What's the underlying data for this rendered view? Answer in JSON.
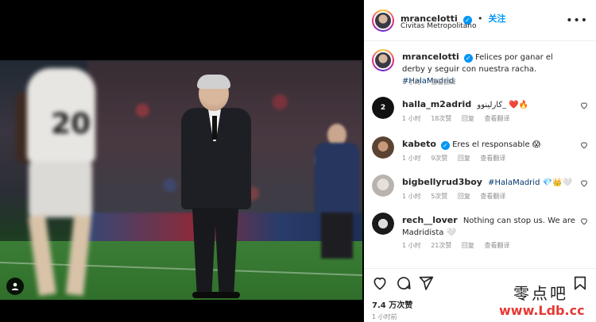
{
  "post": {
    "username": "mrancelotti",
    "follow_label": "关注",
    "location": "Civitas Metropolitano",
    "caption": {
      "username": "mrancelotti",
      "text": "Felices por ganar el derby y seguir con nuestra racha.",
      "hashtag": "#HalaMadrid",
      "time": "1 小时",
      "translate": "查看翻译"
    },
    "comments": [
      {
        "username": "halla_m2adrid",
        "text": "كارلينوو_ ❤️🔥",
        "time": "1 小时",
        "likes": "18次赞",
        "reply": "回复",
        "translate": "查看翻译"
      },
      {
        "username": "kabeto",
        "text": "Eres el responsable 😱",
        "time": "1 小时",
        "likes": "9次赞",
        "reply": "回复",
        "translate": "查看翻译"
      },
      {
        "username": "bigbellyrud3boy",
        "text": "",
        "hashtag": "#HalaMadrid",
        "emoji": "💎👑🤍",
        "time": "1 小时",
        "likes": "5次赞",
        "reply": "回复",
        "translate": "查看翻译"
      },
      {
        "username": "rech__lover",
        "text": "Nothing can stop us. We are Madridista 🤍",
        "time": "1 小时",
        "likes": "21次赞",
        "reply": "回复",
        "translate": "查看翻译"
      }
    ],
    "likes_count": "7.4 万次赞",
    "posted_time": "1 小时前"
  },
  "photo": {
    "jersey_number": "20"
  },
  "watermark": {
    "chinese": "零点吧",
    "url": "www.Ldb.cc"
  },
  "colors": {
    "accent": "#0095f6",
    "hashtag": "#00376b",
    "muted": "#8e8e8e",
    "heart_red": "#ed4956"
  },
  "icons": [
    "more-icon",
    "verified-icon",
    "heart-icon",
    "comment-icon",
    "share-icon",
    "bookmark-icon",
    "user-tag-icon"
  ]
}
